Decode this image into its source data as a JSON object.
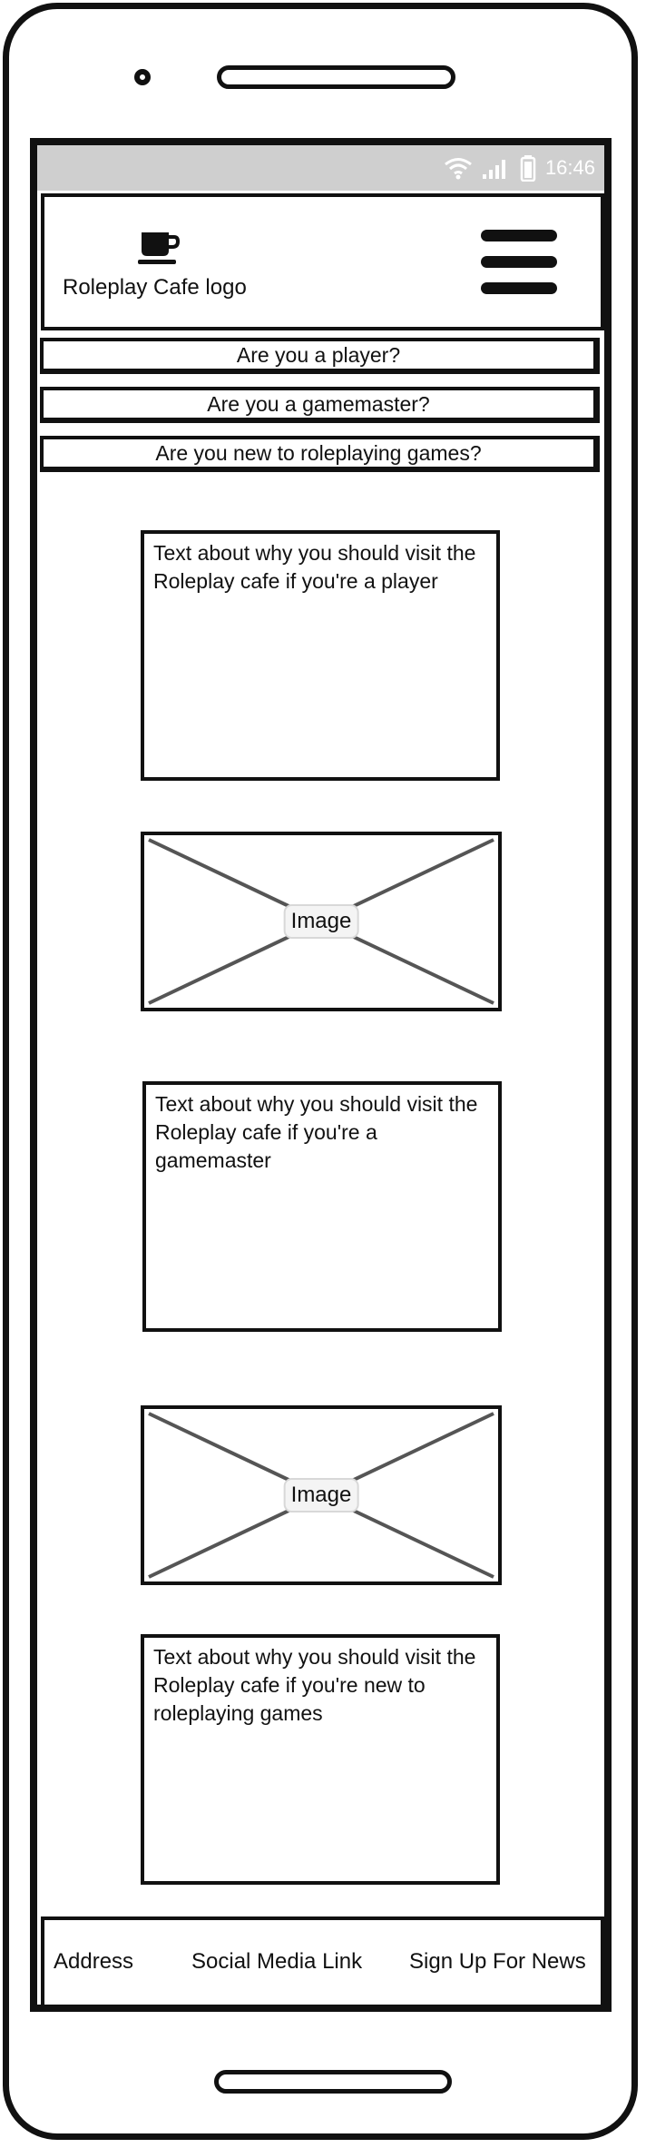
{
  "status_bar": {
    "time": "16:46",
    "icons": [
      "wifi-icon",
      "signal-icon",
      "battery-icon"
    ]
  },
  "header": {
    "logo_text": "Roleplay Cafe logo",
    "logo_icon": "coffee-cup-icon",
    "menu_icon": "hamburger-menu-icon"
  },
  "nav": {
    "items": [
      "Are you a player?",
      "Are you a gamemaster?",
      "Are you new to roleplaying games?"
    ]
  },
  "content": {
    "sections": [
      "Text about why you should visit the Roleplay cafe if you're a player",
      "Text about why you should visit the Roleplay cafe if you're a gamemaster",
      "Text about why you should visit the Roleplay cafe if you're new to roleplaying games"
    ],
    "image_label": "Image"
  },
  "footer": {
    "address": "Address",
    "social": "Social Media Link",
    "signup": "Sign Up For News"
  },
  "colors": {
    "frame": "#111111",
    "status_bar": "#cfcfcf",
    "placeholder_lines": "#555555"
  }
}
